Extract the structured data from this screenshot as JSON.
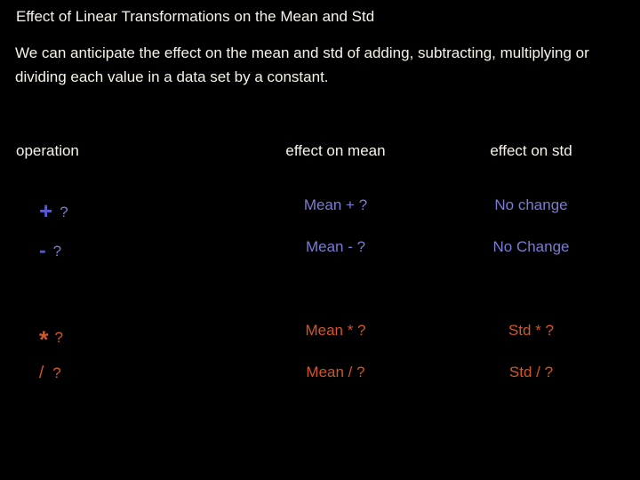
{
  "slide": {
    "background_color": "#000000",
    "title": "Effect of Linear Transformations on the Mean and Std",
    "body": "We can anticipate the effect on the mean and std of adding, subtracting, multiplying or dividing each value in a data set by a constant.",
    "text_color": "#f7f3e7"
  },
  "table": {
    "headers": {
      "operation": "operation",
      "effect_on_mean": "effect on mean",
      "effect_on_std": "effect on std"
    },
    "colors": {
      "add_subtract": "#7b7bd4",
      "add_symbol": "#5a5ad0",
      "multiply_divide": "#d2562a"
    },
    "rows": [
      {
        "symbol": "+",
        "question": "?",
        "effect_on_mean": "Mean + ?",
        "effect_on_std": "No change",
        "color": "#7b7bd4"
      },
      {
        "symbol": "-",
        "question": "?",
        "effect_on_mean": "Mean - ?",
        "effect_on_std": "No Change",
        "color": "#7b7bd4"
      },
      {
        "symbol": "*",
        "question": "?",
        "effect_on_mean": "Mean  * ?",
        "effect_on_std": "Std  * ?",
        "color": "#d2562a"
      },
      {
        "symbol": "/",
        "question": "?",
        "effect_on_mean": "Mean  / ?",
        "effect_on_std": "Std  / ?",
        "color": "#d2562a"
      }
    ]
  }
}
